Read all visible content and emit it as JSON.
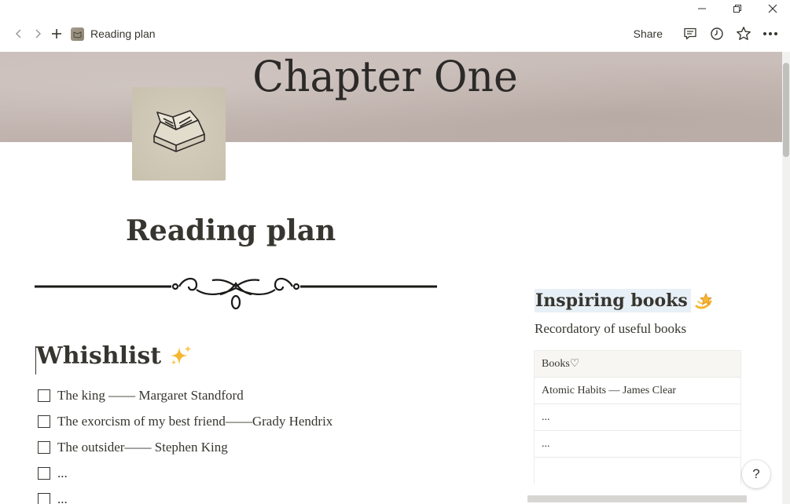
{
  "window": {
    "controls": [
      "minimize-icon",
      "restore-icon",
      "close-icon"
    ]
  },
  "nav": {
    "back_icon": "chevron-left-icon",
    "forward_icon": "chevron-right-icon",
    "new_icon": "plus-icon",
    "breadcrumb_label": "Reading plan"
  },
  "actions": {
    "share_label": "Share",
    "icons": [
      "comment-icon",
      "history-icon",
      "star-icon",
      "more-icon"
    ]
  },
  "cover": {
    "text": "Chapter One"
  },
  "page": {
    "title": "Reading plan"
  },
  "wishlist": {
    "heading": "Whishlist",
    "items": [
      {
        "text": "The king —— Margaret Standford",
        "checked": false
      },
      {
        "text": "The exorcism of my best friend——Grady Hendrix",
        "checked": false
      },
      {
        "text": "The outsider—— Stephen King",
        "checked": false
      },
      {
        "text": "...",
        "checked": false
      },
      {
        "text": "...",
        "checked": false
      }
    ]
  },
  "inspiring": {
    "heading": "Inspiring books",
    "subtitle": "Recordatory of useful books",
    "table": {
      "header": "Books♡",
      "rows": [
        "Atomic Habits — James Clear",
        "...",
        "..."
      ]
    }
  },
  "help": {
    "label": "?"
  },
  "colors": {
    "text": "#37352f",
    "highlight": "#e7f0f6",
    "table_header_bg": "#f7f6f3"
  }
}
